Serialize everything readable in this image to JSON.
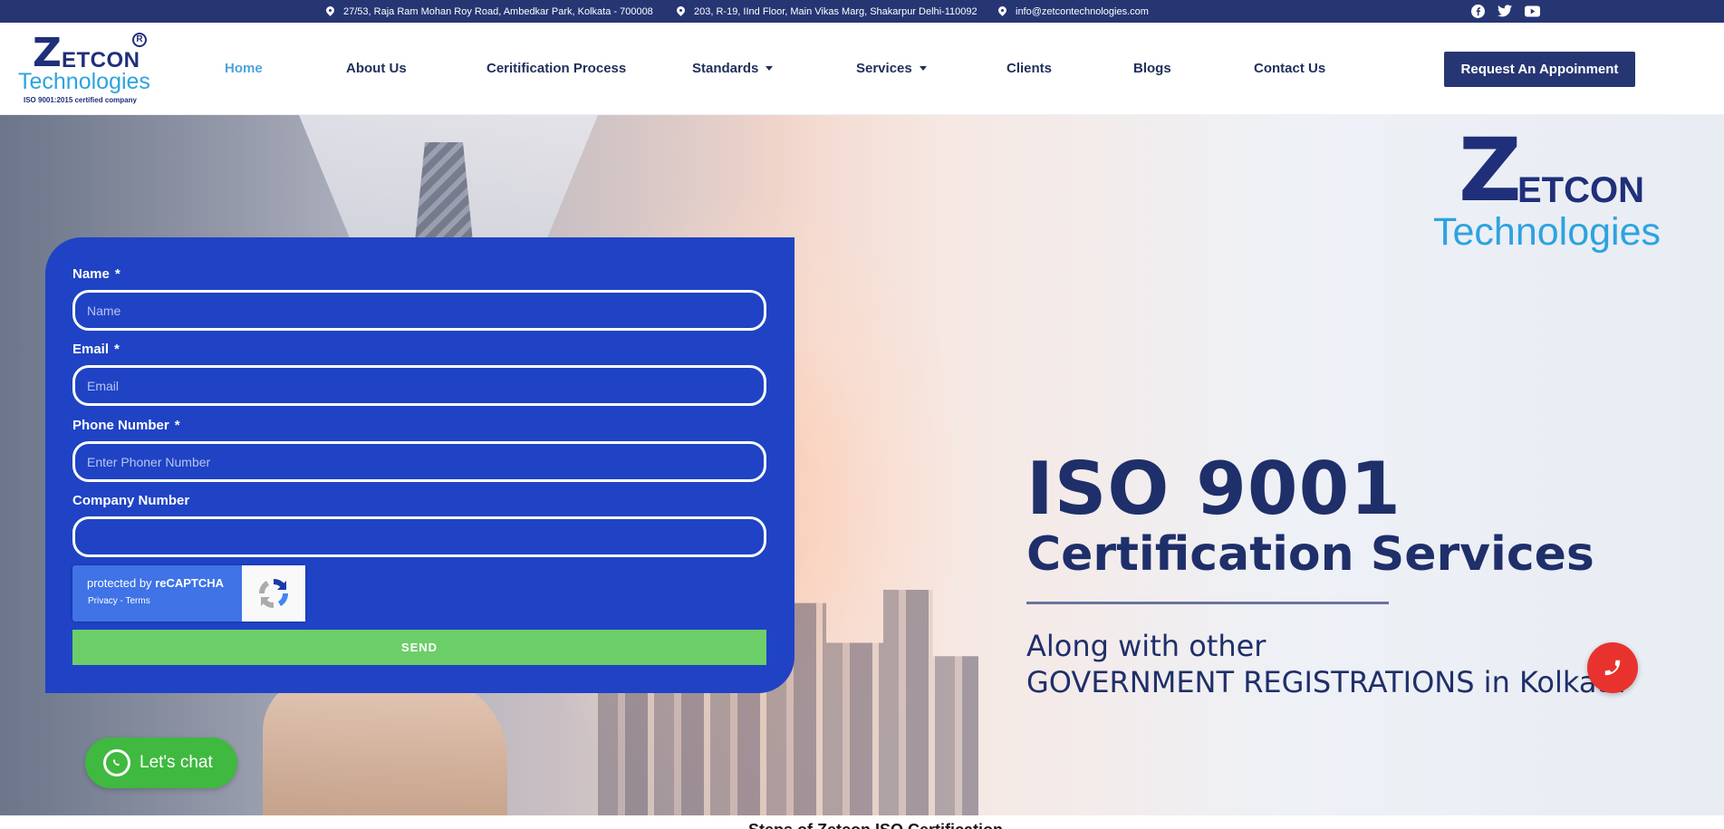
{
  "topbar": {
    "address_1": "27/53, Raja Ram Mohan Roy Road, Ambedkar Park, Kolkata - 700008",
    "address_2": "203, R-19, IInd Floor, Main Vikas Marg, Shakarpur Delhi-110092",
    "email": "info@zetcontechnologies.com",
    "social_icons": [
      "facebook-icon",
      "twitter-icon",
      "youtube-icon"
    ]
  },
  "logo": {
    "z": "Z",
    "etcon": "ETCON",
    "registered": "R",
    "technologies": "Technologies",
    "tagline": "ISO 9001:2015 certified company"
  },
  "nav": {
    "items": [
      {
        "label": "Home",
        "active": true
      },
      {
        "label": "About Us"
      },
      {
        "label": "Ceritification Process"
      },
      {
        "label": "Standards",
        "has_dropdown": true
      },
      {
        "label": "Services",
        "has_dropdown": true
      },
      {
        "label": "Clients"
      },
      {
        "label": "Blogs"
      },
      {
        "label": "Contact Us"
      }
    ],
    "cta_label": "Request An Appoinment"
  },
  "hero": {
    "brand_z": "Z",
    "brand_etcon": "ETCON",
    "brand_technologies": "Technologies",
    "title_line_1": "ISO 9001",
    "title_line_2": "Certification Services",
    "subtitle_line_1": "Along with other",
    "subtitle_line_2": "GOVERNMENT REGISTRATIONS in Kolkata"
  },
  "form": {
    "name_label": "Name",
    "name_placeholder": "Name",
    "email_label": "Email",
    "email_placeholder": "Email",
    "phone_label": "Phone Number",
    "phone_placeholder": "Enter Phoner Number",
    "company_label": "Company Number",
    "company_placeholder": "",
    "required_marker": "*",
    "recaptcha_prefix": "protected by ",
    "recaptcha_brand": "reCAPTCHA",
    "recaptcha_links": "Privacy - Terms",
    "send_label": "SEND"
  },
  "widgets": {
    "chat_label": "Let's chat"
  },
  "below_fold": {
    "heading_partial": "Steps of Zetcon ISO Certification"
  },
  "colors": {
    "navy": "#263673",
    "form_blue": "#1f43c4",
    "accent_light_blue": "#4da3db",
    "send_green": "#6cce68",
    "whatsapp_green": "#3fb93f",
    "call_red": "#e8322e"
  }
}
